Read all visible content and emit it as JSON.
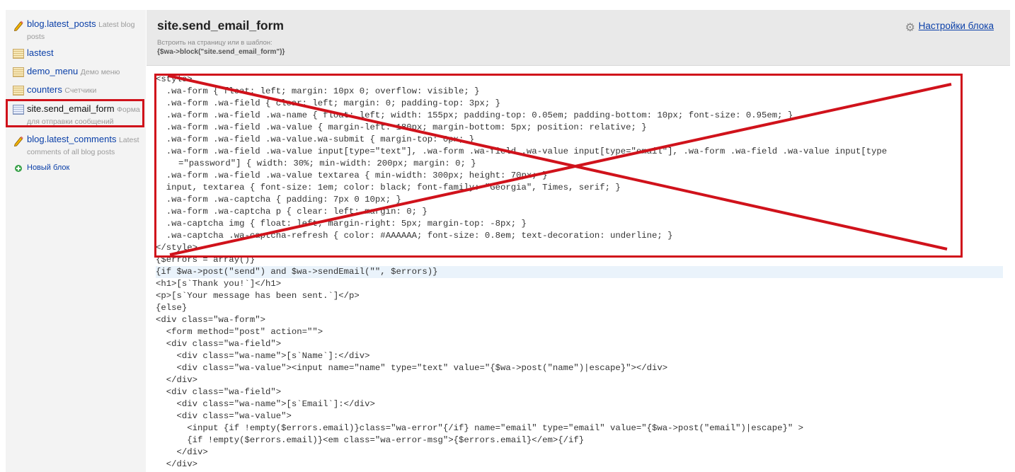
{
  "sidebar": {
    "items": [
      {
        "name": "blog.latest_posts",
        "desc": "Latest blog posts",
        "icon": "pencil-icon"
      },
      {
        "name": "lastest",
        "desc": "",
        "icon": "page-icon"
      },
      {
        "name": "demo_menu",
        "desc": "Демо меню",
        "icon": "page-icon"
      },
      {
        "name": "counters",
        "desc": "Счетчики",
        "icon": "page-icon"
      },
      {
        "name": "site.send_email_form",
        "desc": "Форма для отправки сообщений",
        "icon": "page-icon"
      },
      {
        "name": "blog.latest_comments",
        "desc": "Latest comments of all blog posts",
        "icon": "pencil-icon"
      }
    ],
    "new_block": "Новый блок"
  },
  "header": {
    "title": "site.send_email_form",
    "embed_hint": "Встроить на страницу или в шаблон:",
    "embed_code": "{$wa->block(\"site.send_email_form\")}",
    "settings": "Настройки блока"
  },
  "code": [
    "<style>",
    "  .wa-form { float: left; margin: 10px 0; overflow: visible; }",
    "  .wa-form .wa-field { clear: left; margin: 0; padding-top: 3px; }",
    "  .wa-form .wa-field .wa-name { float: left; width: 155px; padding-top: 0.05em; padding-bottom: 10px; font-size: 0.95em; }",
    "  .wa-form .wa-field .wa-value { margin-left: 180px; margin-bottom: 5px; position: relative; }",
    "  .wa-form .wa-field .wa-value.wa-submit { margin-top: 0px; }",
    "  .wa-form .wa-field .wa-value input[type=\"text\"], .wa-form .wa-field .wa-value input[type=\"email\"], .wa-form .wa-field .wa-value input[type",
    "=\"password\"] { width: 30%; min-width: 200px; margin: 0; }",
    "  .wa-form .wa-field .wa-value textarea { min-width: 300px; height: 70px; }",
    "  input, textarea { font-size: 1em; color: black; font-family: \"Georgia\", Times, serif; }",
    "  .wa-form .wa-captcha { padding: 7px 0 10px; }",
    "  .wa-form .wa-captcha p { clear: left; margin: 0; }",
    "  .wa-captcha img { float: left; margin-right: 5px; margin-top: -8px; }",
    "  .wa-captcha .wa-captcha-refresh { color: #AAAAAA; font-size: 0.8em; text-decoration: underline; }",
    "</style>",
    "{$errors = array()}",
    "{if $wa->post(\"send\") and $wa->sendEmail(\"\", $errors)}",
    "<h1>[s`Thank you!`]</h1>",
    "<p>[s`Your message has been sent.`]</p>",
    "{else}",
    "<div class=\"wa-form\">",
    "  <form method=\"post\" action=\"\">",
    "  <div class=\"wa-field\">",
    "    <div class=\"wa-name\">[s`Name`]:</div>",
    "    <div class=\"wa-value\"><input name=\"name\" type=\"text\" value=\"{$wa->post(\"name\")|escape}\"></div>",
    "  </div>",
    "  <div class=\"wa-field\">",
    "    <div class=\"wa-name\">[s`Email`]:</div>",
    "    <div class=\"wa-value\">",
    "      <input {if !empty($errors.email)}class=\"wa-error\"{/if} name=\"email\" type=\"email\" value=\"{$wa->post(\"email\")|escape}\" >",
    "      {if !empty($errors.email)}<em class=\"wa-error-msg\">{$errors.email}</em>{/if}",
    "    </div>",
    "  </div>"
  ],
  "annotation": {
    "color": "#d0121b"
  },
  "colors": {
    "link": "#0a3fa8",
    "sidebar_bg": "#f3f3f3",
    "header_bg": "#e9e9e9"
  }
}
